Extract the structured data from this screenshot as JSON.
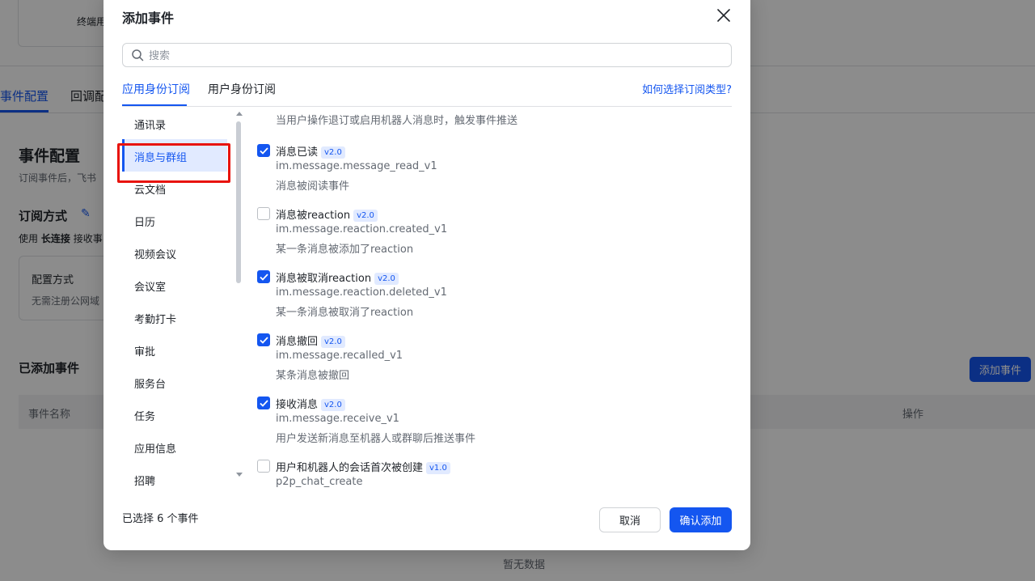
{
  "background": {
    "card_label": "终端用",
    "tabs": [
      {
        "label": "事件配置"
      },
      {
        "label": "回调配"
      }
    ],
    "section_title": "事件配置",
    "section_desc": "订阅事件后，飞书",
    "sub_title": "订阅方式",
    "method_prefix": "使用",
    "method_bold": "长连接",
    "method_suffix": "接收事",
    "config_box": {
      "title": "配置方式",
      "value": "无需注册公网域"
    },
    "added_title": "已添加事件",
    "add_button": "添加事件",
    "table_headers": {
      "name": "事件名称",
      "action": "操作"
    },
    "empty_text": "暂无数据"
  },
  "modal": {
    "title": "添加事件",
    "search_placeholder": "搜索",
    "tabs": [
      {
        "label": "应用身份订阅",
        "active": true
      },
      {
        "label": "用户身份订阅",
        "active": false
      }
    ],
    "help_link": "如何选择订阅类型?",
    "categories": [
      {
        "label": "通讯录"
      },
      {
        "label": "消息与群组",
        "active": true
      },
      {
        "label": "云文档"
      },
      {
        "label": "日历"
      },
      {
        "label": "视频会议"
      },
      {
        "label": "会议室"
      },
      {
        "label": "考勤打卡"
      },
      {
        "label": "审批"
      },
      {
        "label": "服务台"
      },
      {
        "label": "任务"
      },
      {
        "label": "应用信息"
      },
      {
        "label": "招聘"
      }
    ],
    "partial_event_desc": "当用户操作退订或启用机器人消息时，触发事件推送",
    "events": [
      {
        "name": "消息已读",
        "version": "v2.0",
        "key": "im.message.message_read_v1",
        "desc": "消息被阅读事件",
        "checked": true
      },
      {
        "name": "消息被reaction",
        "version": "v2.0",
        "key": "im.message.reaction.created_v1",
        "desc": "某一条消息被添加了reaction",
        "checked": false
      },
      {
        "name": "消息被取消reaction",
        "version": "v2.0",
        "key": "im.message.reaction.deleted_v1",
        "desc": "某一条消息被取消了reaction",
        "checked": true
      },
      {
        "name": "消息撤回",
        "version": "v2.0",
        "key": "im.message.recalled_v1",
        "desc": "某条消息被撤回",
        "checked": true
      },
      {
        "name": "接收消息",
        "version": "v2.0",
        "key": "im.message.receive_v1",
        "desc": "用户发送新消息至机器人或群聊后推送事件",
        "checked": true
      },
      {
        "name": "用户和机器人的会话首次被创建",
        "version": "v1.0",
        "key": "p2p_chat_create",
        "desc": "",
        "checked": false
      }
    ],
    "selected_count": "已选择 6 个事件",
    "cancel_label": "取消",
    "confirm_label": "确认添加"
  },
  "colors": {
    "accent": "#1456f0",
    "highlight": "#e8130d"
  }
}
